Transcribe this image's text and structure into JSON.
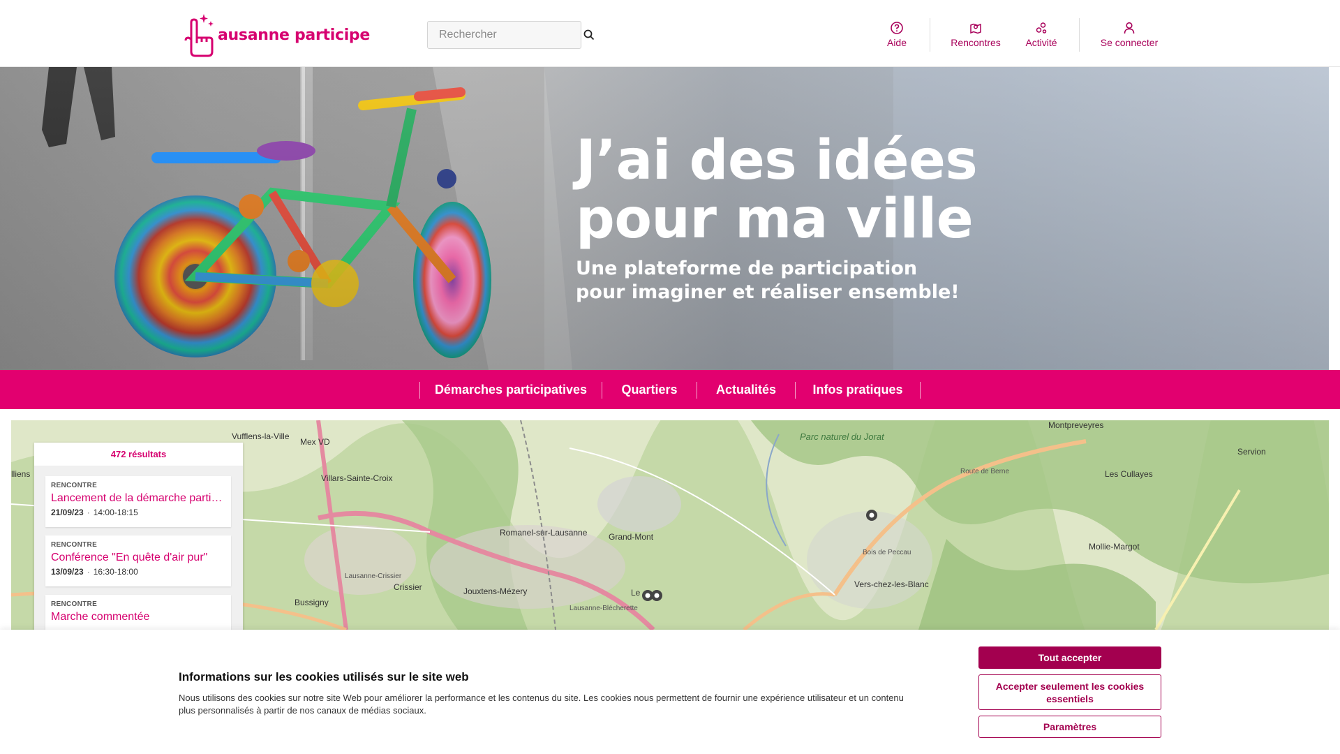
{
  "header": {
    "logo_text": "ausanne participe",
    "search": {
      "placeholder": "Rechercher"
    },
    "nav": [
      {
        "label": "Aide",
        "icon": "help-icon"
      },
      {
        "label": "Rencontres",
        "icon": "map-pin-icon"
      },
      {
        "label": "Activité",
        "icon": "activity-icon"
      },
      {
        "label": "Se connecter",
        "icon": "user-icon"
      }
    ]
  },
  "hero": {
    "title_line1": "J’ai des idées",
    "title_line2": "pour ma ville",
    "subtitle_line1": "Une plateforme de participation",
    "subtitle_line2": "pour imaginer et réaliser ensemble!"
  },
  "main_nav": [
    {
      "label": "Démarches participatives"
    },
    {
      "label": "Quartiers"
    },
    {
      "label": "Actualités"
    },
    {
      "label": "Infos pratiques"
    }
  ],
  "map": {
    "labels": [
      "Vufflens-la-Ville",
      "Mex VD",
      "Montpreveyres",
      "Servion",
      "Les Cullayes",
      "Parc naturel du Jorat",
      "Villars-Sainte-Croix",
      "Romanel-sur-Lausanne",
      "Grand-Mont",
      "Crissier",
      "Jouxtens-Mézery",
      "Bussigny",
      "Vers-chez-les-Blanc",
      "Mollie-Margot",
      "Le",
      "Lausanne-Blécherette",
      "Lausanne-Crissier",
      "Bois de Peccau",
      "Route de Berne",
      "lliens"
    ]
  },
  "results": {
    "count": "472 résultats",
    "items": [
      {
        "type": "RENCONTRE",
        "title": "Lancement de la démarche participative",
        "date": "21/09/23",
        "time": "14:00-18:15"
      },
      {
        "type": "RENCONTRE",
        "title": "Conférence \"En quête d'air pur\"",
        "date": "13/09/23",
        "time": "16:30-18:00"
      },
      {
        "type": "RENCONTRE",
        "title": "Marche commentée",
        "date": "",
        "time": ""
      }
    ]
  },
  "cookie": {
    "title": "Informations sur les cookies utilisés sur le site web",
    "text": "Nous utilisons des cookies sur notre site Web pour améliorer la performance et les contenus du site. Les cookies nous permettent de fournir une expérience utilisateur et un contenu plus personnalisés à partir de nos canaux de médias sociaux.",
    "accept_all": "Tout accepter",
    "accept_essential": "Accepter seulement les cookies essentiels",
    "settings": "Paramètres"
  },
  "colors": {
    "brand_pink": "#e2006f",
    "brand_dark": "#a3004f"
  }
}
